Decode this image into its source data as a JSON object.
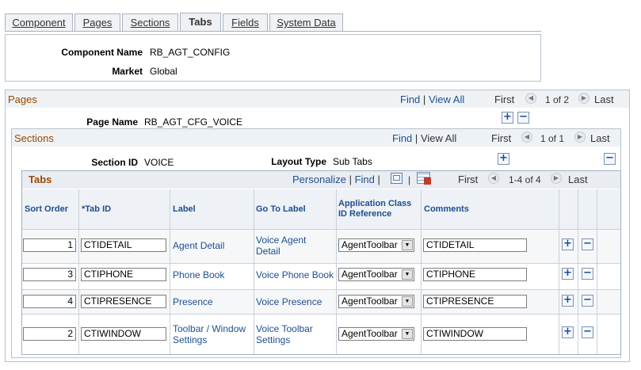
{
  "tabs": [
    {
      "label": "Component",
      "active": false
    },
    {
      "label": "Pages",
      "active": false
    },
    {
      "label": "Sections",
      "active": false
    },
    {
      "label": "Tabs",
      "active": true
    },
    {
      "label": "Fields",
      "active": false
    },
    {
      "label": "System Data",
      "active": false
    }
  ],
  "component": {
    "name_label": "Component Name",
    "name_value": "RB_AGT_CONFIG",
    "market_label": "Market",
    "market_value": "Global"
  },
  "pages": {
    "title": "Pages",
    "find": "Find",
    "sep": "|",
    "view_all": "View All",
    "first": "First",
    "counter": "1 of 2",
    "last": "Last",
    "page_name_label": "Page Name",
    "page_name_value": "RB_AGT_CFG_VOICE"
  },
  "sections": {
    "title": "Sections",
    "find": "Find",
    "sep": "|",
    "view_all": "View All",
    "first": "First",
    "counter": "1 of 1",
    "last": "Last",
    "section_id_label": "Section ID",
    "section_id_value": "VOICE",
    "layout_type_label": "Layout Type",
    "layout_type_value": "Sub Tabs"
  },
  "grid": {
    "title": "Tabs",
    "personalize": "Personalize",
    "sep": "|",
    "find": "Find",
    "first": "First",
    "counter": "1-4 of 4",
    "last": "Last",
    "columns": {
      "sort_order": "Sort Order",
      "tab_id": "*Tab ID",
      "label": "Label",
      "go_to_label": "Go To Label",
      "app_class_1": "Application Class",
      "app_class_2": "ID Reference",
      "comments": "Comments"
    },
    "rows": [
      {
        "sort_order": "1",
        "tab_id": "CTIDETAIL",
        "label_1": "Agent Detail",
        "label_2": "",
        "go_to_1": "Voice Agent",
        "go_to_2": "Detail",
        "app_class": "AgentToolbar",
        "comments": "CTIDETAIL"
      },
      {
        "sort_order": "3",
        "tab_id": "CTIPHONE",
        "label_1": "Phone Book",
        "label_2": "",
        "go_to_1": "Voice Phone Book",
        "go_to_2": "",
        "app_class": "AgentToolbar",
        "comments": "CTIPHONE"
      },
      {
        "sort_order": "4",
        "tab_id": "CTIPRESENCE",
        "label_1": "Presence",
        "label_2": "",
        "go_to_1": "Voice Presence",
        "go_to_2": "",
        "app_class": "AgentToolbar",
        "comments": "CTIPRESENCE"
      },
      {
        "sort_order": "2",
        "tab_id": "CTIWINDOW",
        "label_1": "Toolbar / Window",
        "label_2": "Settings",
        "go_to_1": "Voice Toolbar",
        "go_to_2": "Settings",
        "app_class": "AgentToolbar",
        "comments": "CTIWINDOW"
      }
    ]
  },
  "icons": {
    "add": "+",
    "delete": "−",
    "prev": "◀",
    "next": "▶",
    "dropdown": "▼"
  }
}
